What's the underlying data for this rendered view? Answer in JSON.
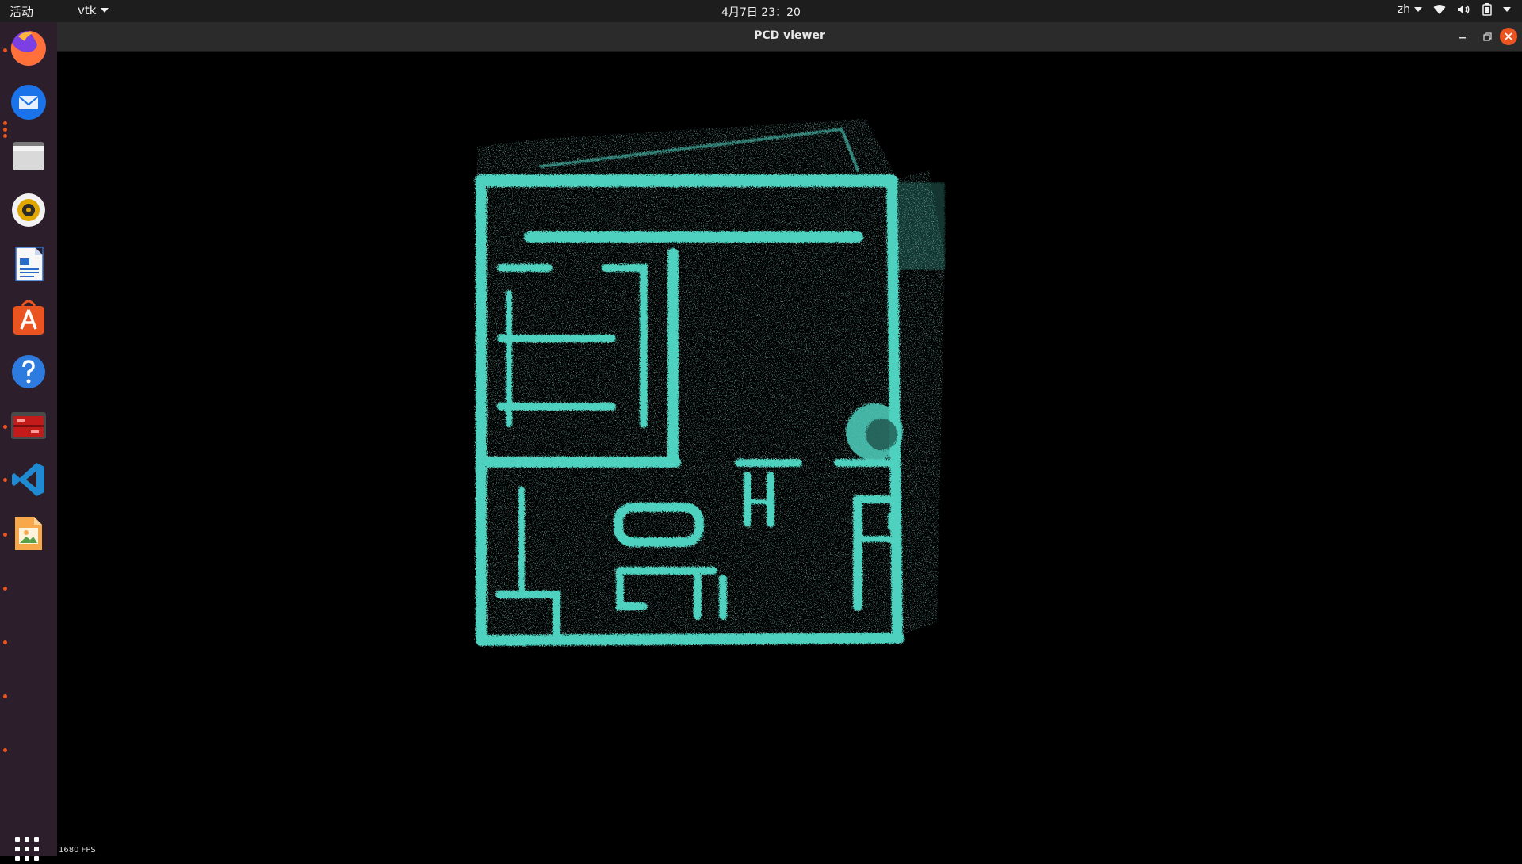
{
  "topbar": {
    "activities": "活动",
    "app_menu": "vtk",
    "clock": "4月7日 23：20",
    "language": "zh"
  },
  "window": {
    "title": "PCD viewer",
    "fps_text": "1680 FPS"
  },
  "dock": {
    "apps": [
      "firefox-icon",
      "thunderbird-icon",
      "files-icon",
      "rhythmbox-icon",
      "libreoffice-writer-icon",
      "software-center-icon",
      "help-icon",
      "terminal-app-icon",
      "vscode-icon",
      "image-viewer-icon"
    ],
    "show_apps": "app-grid-icon"
  },
  "colors": {
    "point_cloud": "#4fd1c0",
    "accent": "#e95420",
    "dock_bg": "#2c1e2a",
    "topbar_bg": "#1d1d1d"
  }
}
